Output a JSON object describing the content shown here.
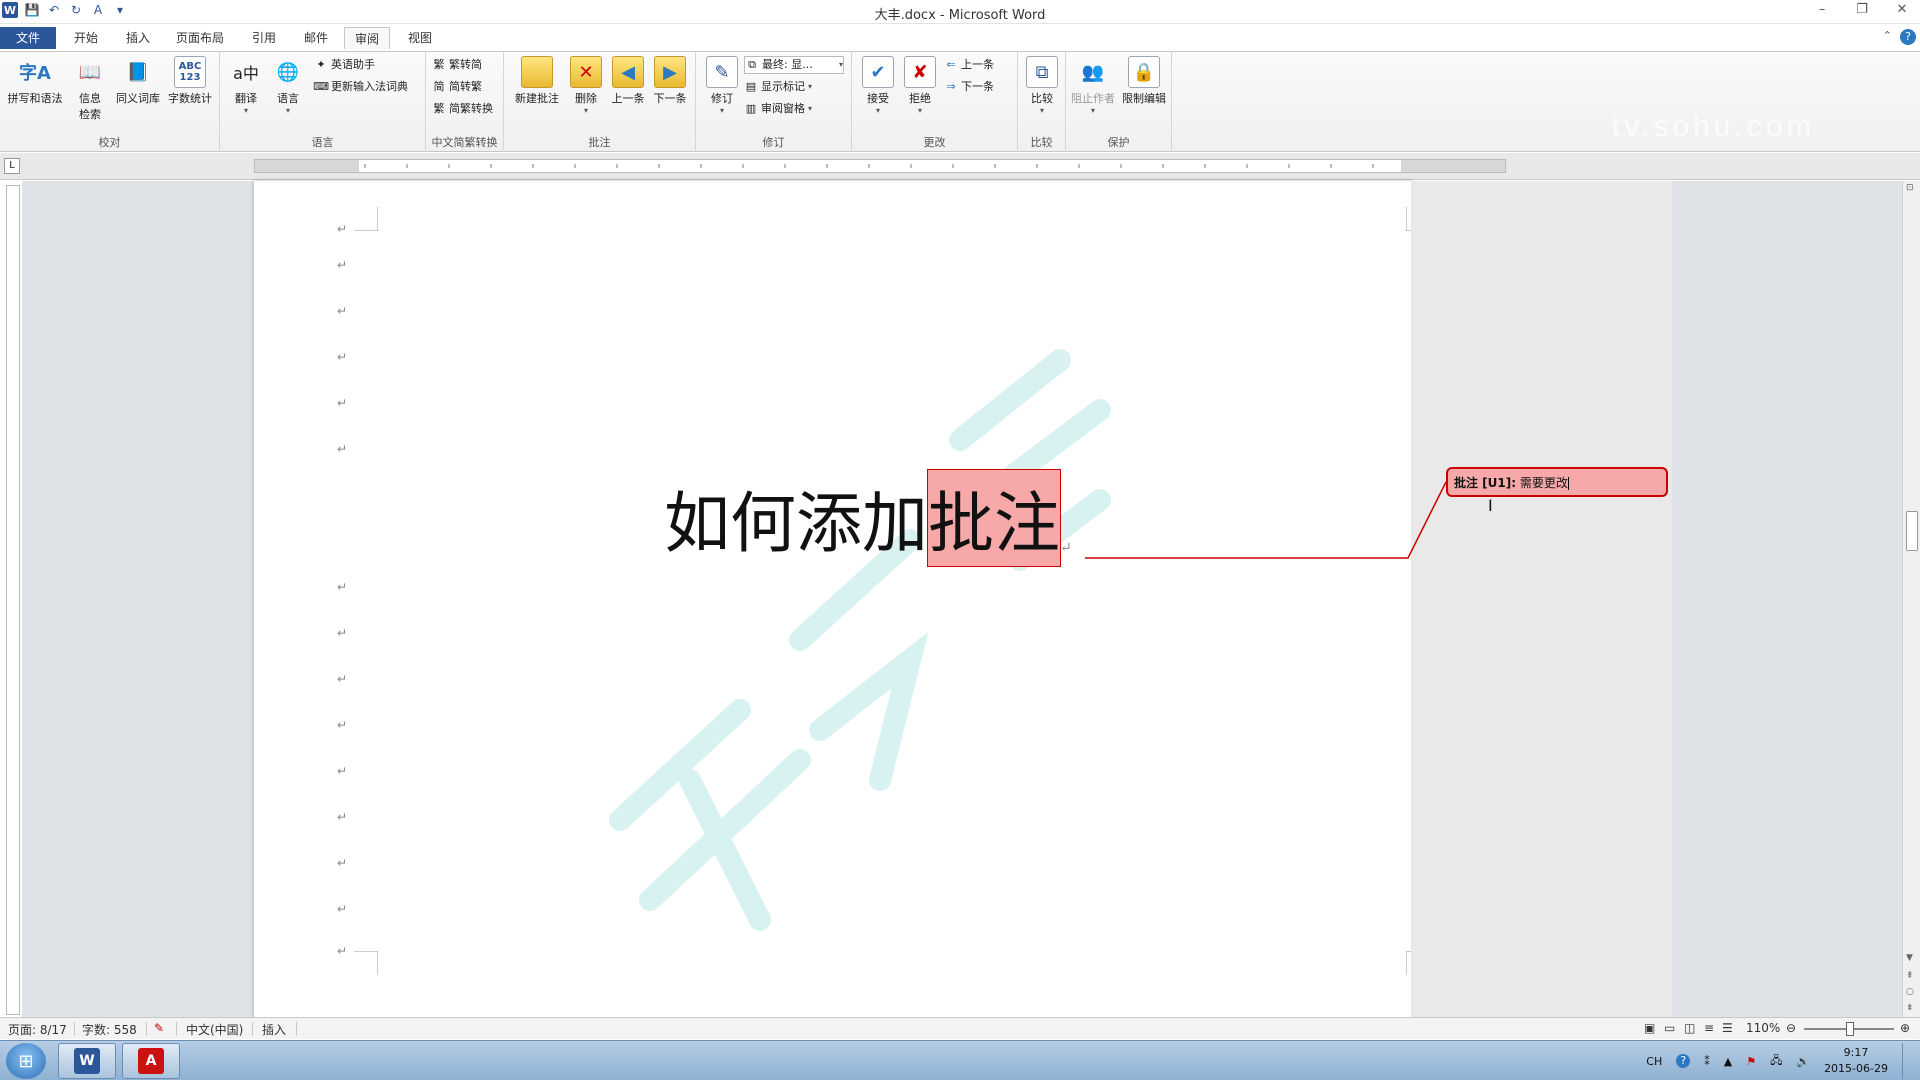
{
  "window": {
    "title": "大丰.docx - Microsoft Word"
  },
  "tabs": [
    {
      "label": "文件"
    },
    {
      "label": "开始"
    },
    {
      "label": "插入"
    },
    {
      "label": "页面布局"
    },
    {
      "label": "引用"
    },
    {
      "label": "邮件"
    },
    {
      "label": "审阅"
    },
    {
      "label": "视图"
    }
  ],
  "ribbon": {
    "proofing": {
      "label": "校对",
      "spelling": "拼写和语法",
      "research_1": "信息",
      "research_2": "检索",
      "thesaurus": "同义词库",
      "word_count": "字数统计"
    },
    "language": {
      "label": "语言",
      "translate": "翻译",
      "language": "语言",
      "english_assistant": "英语助手",
      "update_ime": "更新输入法词典"
    },
    "chinese": {
      "label": "中文简繁转换",
      "to_simplified": "繁转简",
      "to_traditional": "简转繁",
      "convert": "简繁转换"
    },
    "comments": {
      "label": "批注",
      "new": "新建批注",
      "delete": "删除",
      "previous": "上一条",
      "next": "下一条"
    },
    "tracking": {
      "label": "修订",
      "track": "修订",
      "final_show": "最终: 显...",
      "show_markup": "显示标记",
      "review_pane": "审阅窗格"
    },
    "changes": {
      "label": "更改",
      "accept": "接受",
      "reject": "拒绝",
      "previous": "上一条",
      "next": "下一条"
    },
    "compare": {
      "label": "比较",
      "compare": "比较"
    },
    "protect": {
      "label": "保护",
      "block_authors": "阻止作者",
      "restrict_editing": "限制编辑"
    }
  },
  "document": {
    "title_plain": "如何添加",
    "title_highlight": "批注",
    "para_mark": "↵"
  },
  "comment": {
    "label": "批注 [U1]:",
    "text": "需要更改"
  },
  "statusbar": {
    "page": "页面: 8/17",
    "words": "字数: 558",
    "language": "中文(中国)",
    "mode": "插入",
    "zoom": "110%"
  },
  "taskbar": {
    "ime": "CH",
    "time": "9:17",
    "date": "2015-06-29"
  },
  "watermark_text": "tv.sohu.com",
  "colors": {
    "accent": "#2b579a",
    "comment_fill": "#f7a8a8",
    "comment_border": "#cc0000"
  }
}
